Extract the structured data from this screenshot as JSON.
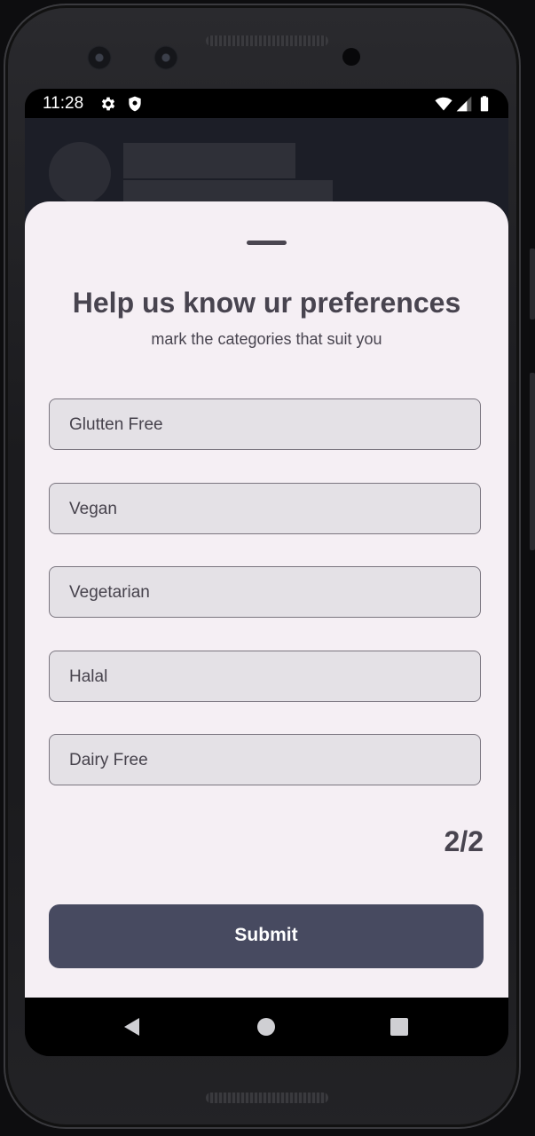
{
  "status_bar": {
    "time": "11:28",
    "icons": [
      "settings-icon",
      "shield-icon",
      "wifi-icon",
      "signal-icon",
      "battery-icon"
    ]
  },
  "sheet": {
    "title": "Help us know ur preferences",
    "subtitle": "mark the categories that suit you",
    "options": [
      {
        "label": "Glutten Free"
      },
      {
        "label": "Vegan"
      },
      {
        "label": "Vegetarian"
      },
      {
        "label": "Halal"
      },
      {
        "label": "Dairy Free"
      }
    ],
    "page_counter": "2/2",
    "submit_label": "Submit"
  },
  "colors": {
    "sheet_background": "#f5eff4",
    "option_background": "#e4e1e6",
    "submit_background": "#474a60",
    "app_background": "#1c1e27"
  },
  "nav_bar": {
    "icons": [
      "back-icon",
      "home-icon",
      "recents-icon"
    ]
  }
}
